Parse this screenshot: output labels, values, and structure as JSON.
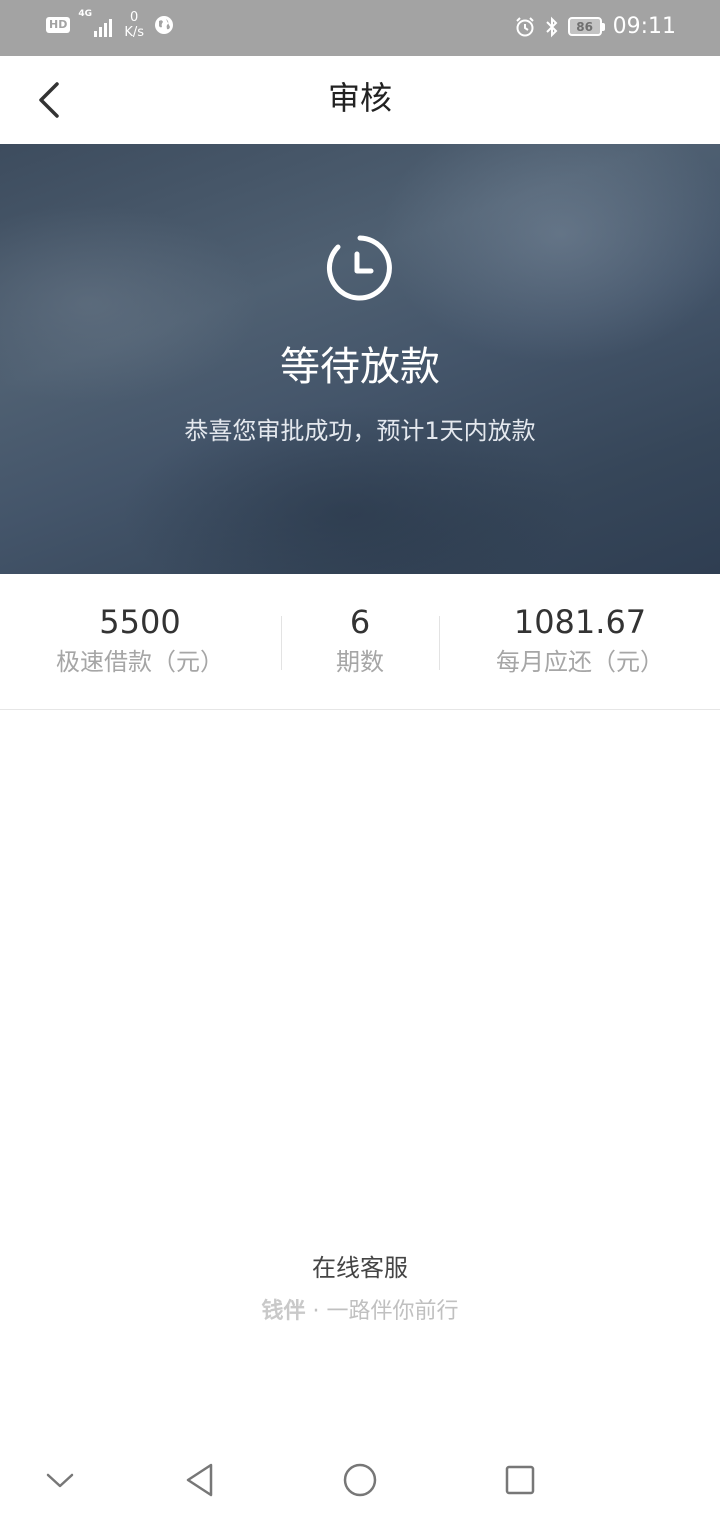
{
  "status_bar": {
    "hd": "HD",
    "network": "4G",
    "speed_value": "0",
    "speed_unit": "K/s",
    "battery": "86",
    "time": "09:11"
  },
  "nav": {
    "title": "审核"
  },
  "hero": {
    "title": "等待放款",
    "subtitle": "恭喜您审批成功，预计1天内放款"
  },
  "stats": [
    {
      "value": "5500",
      "label": "极速借款（元）"
    },
    {
      "value": "6",
      "label": "期数"
    },
    {
      "value": "1081.67",
      "label": "每月应还（元）"
    }
  ],
  "footer": {
    "service": "在线客服",
    "brand": "钱伴",
    "separator": "·",
    "slogan": "一路伴你前行"
  },
  "colors": {
    "status_bar_bg": "#a3a3a3",
    "hero_bg": "#44556a",
    "value_text": "#333333",
    "label_text": "#a6a6a6"
  },
  "icons": {
    "back": "chevron-left-icon",
    "hero": "clock-icon",
    "alarm": "alarm-icon",
    "bluetooth": "bluetooth-icon",
    "globe": "globe-icon",
    "sys_down": "chevron-down-icon",
    "sys_back": "triangle-back-icon",
    "sys_home": "circle-home-icon",
    "sys_recent": "square-recent-icon"
  }
}
